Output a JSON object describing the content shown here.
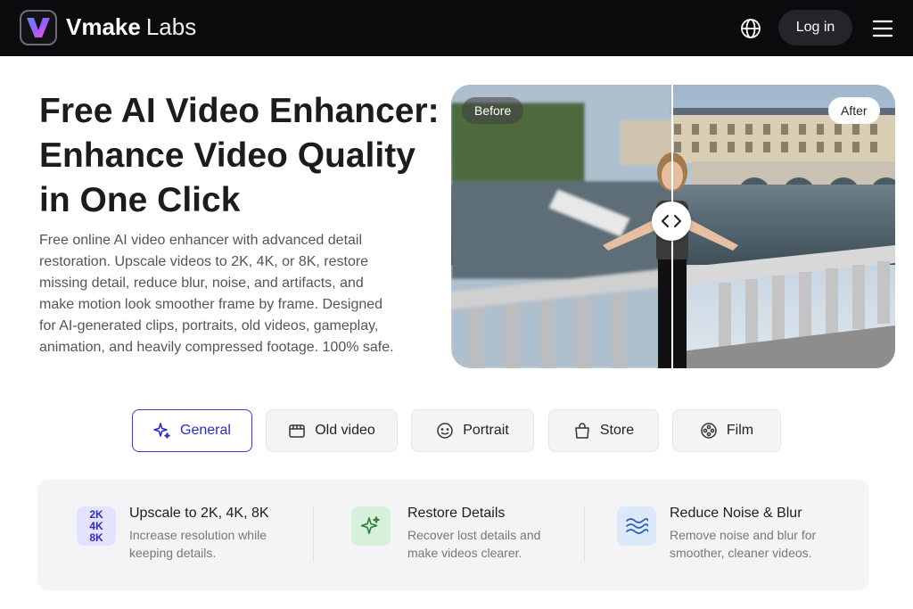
{
  "header": {
    "brand_name": "Vmake",
    "brand_suffix": "Labs",
    "login_label": "Log in",
    "icons": [
      "vmake-logo-icon",
      "globe-icon",
      "hamburger-menu-icon"
    ]
  },
  "hero": {
    "title": "Free AI Video Enhancer: Enhance Video Quality in One Click",
    "description": "Free online AI video enhancer with advanced detail restoration. Upscale videos to 2K, 4K, or 8K, restore missing detail, reduce blur, noise, and artifacts, and make motion look smoother frame by frame. Designed for AI-generated clips, portraits, old videos, gameplay, animation, and heavily compressed footage. 100% safe.",
    "before_label": "Before",
    "after_label": "After"
  },
  "tabs": [
    {
      "label": "General",
      "icon": "sparkle-icon",
      "active": true
    },
    {
      "label": "Old video",
      "icon": "film-reel-icon",
      "active": false
    },
    {
      "label": "Portrait",
      "icon": "smiley-face-icon",
      "active": false
    },
    {
      "label": "Store",
      "icon": "shopping-bag-icon",
      "active": false
    },
    {
      "label": "Film",
      "icon": "film-roll-icon",
      "active": false
    }
  ],
  "features": [
    {
      "title": "Upscale to 2K, 4K, 8K",
      "desc_line1": "Increase resolution while",
      "desc_line2": "keeping details.",
      "badge_lines": [
        "2K",
        "4K",
        "8K"
      ],
      "color": "#e4e3ff"
    },
    {
      "title": "Restore Details",
      "desc_line1": "Recover lost details and",
      "desc_line2": "make videos clearer.",
      "icon": "sparkle-icon",
      "color": "#d6f0d9"
    },
    {
      "title": "Reduce Noise & Blur",
      "desc_line1": "Remove noise and blur for",
      "desc_line2": "smoother, cleaner videos.",
      "icon": "waves-icon",
      "color": "#dbe9fb"
    }
  ],
  "colors": {
    "accent": "#3b3be0",
    "header_bg": "#0b0b0d"
  }
}
